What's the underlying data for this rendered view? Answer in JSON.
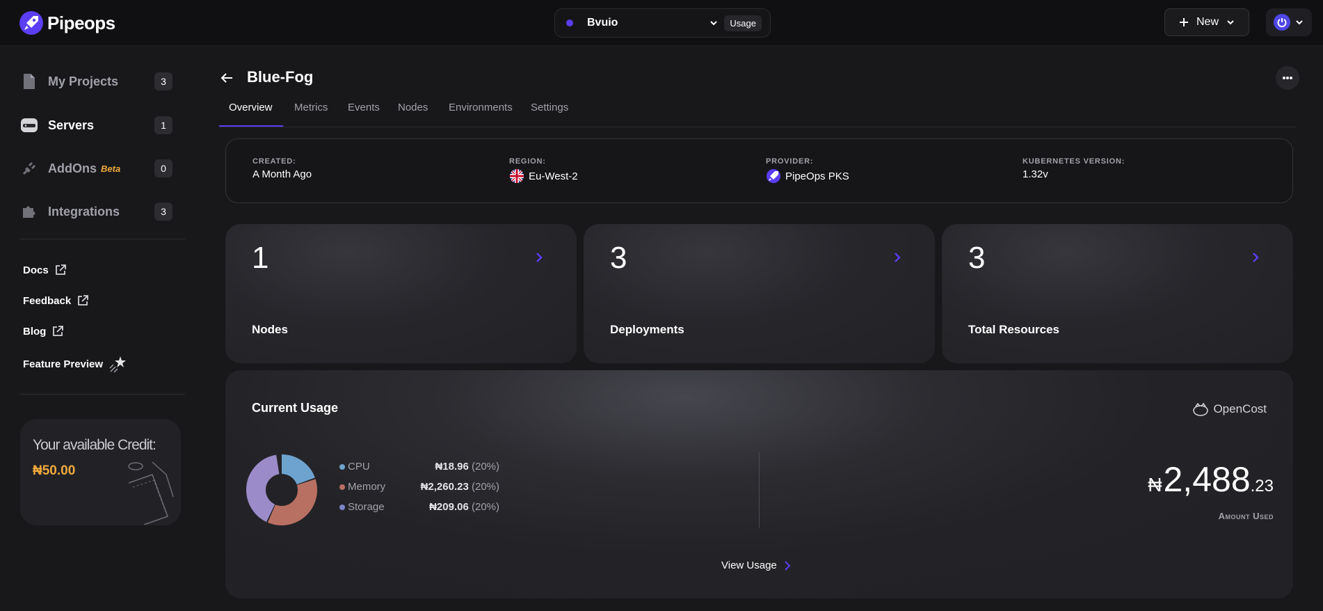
{
  "header": {
    "brand": "Pipeops",
    "org_name": "Bvuio",
    "usage_label": "Usage",
    "new_label": "New"
  },
  "sidebar": {
    "items": [
      {
        "label": "My Projects",
        "count": "3"
      },
      {
        "label": "Servers",
        "count": "1"
      },
      {
        "label": "AddOns",
        "badge": "Beta",
        "count": "0"
      },
      {
        "label": "Integrations",
        "count": "3"
      }
    ],
    "links": [
      {
        "label": "Docs"
      },
      {
        "label": "Feedback"
      },
      {
        "label": "Blog"
      },
      {
        "label": "Feature Preview"
      }
    ],
    "credit": {
      "label": "Your available Credit:",
      "value": "₦50.00"
    }
  },
  "page": {
    "title": "Blue-Fog",
    "tabs": [
      "Overview",
      "Metrics",
      "Events",
      "Nodes",
      "Environments",
      "Settings"
    ],
    "active_tab": "Overview"
  },
  "info": {
    "created": {
      "label": "CREATED:",
      "value": "A Month Ago"
    },
    "region": {
      "label": "REGION:",
      "value": "Eu-West-2"
    },
    "provider": {
      "label": "PROVIDER:",
      "value": "PipeOps PKS"
    },
    "k8s": {
      "label": "KUBERNETES VERSION:",
      "value": "1.32v"
    }
  },
  "stats": [
    {
      "value": "1",
      "label": "Nodes"
    },
    {
      "value": "3",
      "label": "Deployments"
    },
    {
      "value": "3",
      "label": "Total Resources"
    }
  ],
  "usage": {
    "title": "Current Usage",
    "provider": "OpenCost",
    "legend": [
      {
        "name": "CPU",
        "amount": "₦18.96",
        "pct": "(20%)",
        "color": "#6fa3cf"
      },
      {
        "name": "Memory",
        "amount": "₦2,260.23",
        "pct": "(20%)",
        "color": "#b87063"
      },
      {
        "name": "Storage",
        "amount": "₦209.06",
        "pct": "(20%)",
        "color": "#7b86c7"
      }
    ],
    "donut_colors": [
      "#6fa3cf",
      "#b87063",
      "#9b8bc8"
    ],
    "amount_currency": "₦",
    "amount_whole": "2,488",
    "amount_decimal": ".23",
    "amount_label": "Amount Used",
    "view_label": "View Usage"
  },
  "colors": {
    "accent": "#5b3df5",
    "credit": "#f0a93b"
  }
}
